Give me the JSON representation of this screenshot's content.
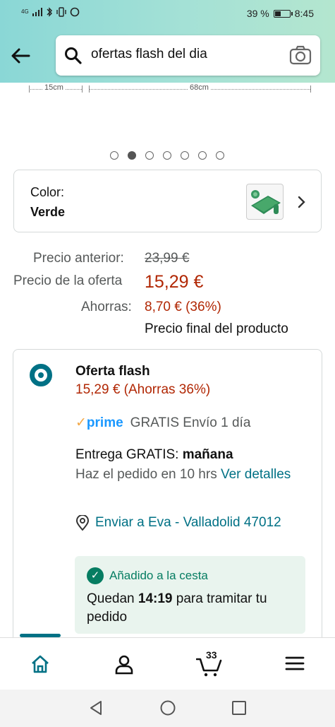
{
  "status_bar": {
    "network": "4G",
    "battery_percent": "39 %",
    "battery_level": 0.39,
    "time": "8:45"
  },
  "search": {
    "query": "ofertas flash del dia"
  },
  "dimensions": {
    "left": "15cm",
    "right": "68cm"
  },
  "carousel": {
    "count": 7,
    "active_index": 1
  },
  "color_selector": {
    "label": "Color:",
    "value": "Verde"
  },
  "pricing": {
    "previous_label": "Precio anterior:",
    "previous_value": "23,99 €",
    "deal_label": "Precio de la oferta",
    "deal_value": "15,29 €",
    "savings_label": "Ahorras:",
    "savings_value": "8,70 € (36%)",
    "final_note": "Precio final del producto"
  },
  "offer": {
    "title": "Oferta flash",
    "price": "15,29 € (Ahorras 36%)",
    "prime_logo": "prime",
    "prime_text": "GRATIS Envío 1 día",
    "delivery_prefix": "Entrega GRATIS: ",
    "delivery_day": "mañana",
    "order_text": "Haz el pedido en 10 hrs ",
    "details_link": "Ver detalles",
    "ship_to": "Enviar a Eva - Valladolid 47012",
    "cart_added": "Añadido a la cesta",
    "cart_time_prefix": "Quedan ",
    "cart_time": "14:19",
    "cart_time_suffix": " para tramitar tu pedido"
  },
  "bottom_nav": {
    "cart_count": "33",
    "items": [
      "home-icon",
      "account-icon",
      "cart-icon",
      "menu-icon"
    ]
  },
  "colors": {
    "accent": "#007185",
    "price": "#b12704",
    "success": "#067d62"
  }
}
